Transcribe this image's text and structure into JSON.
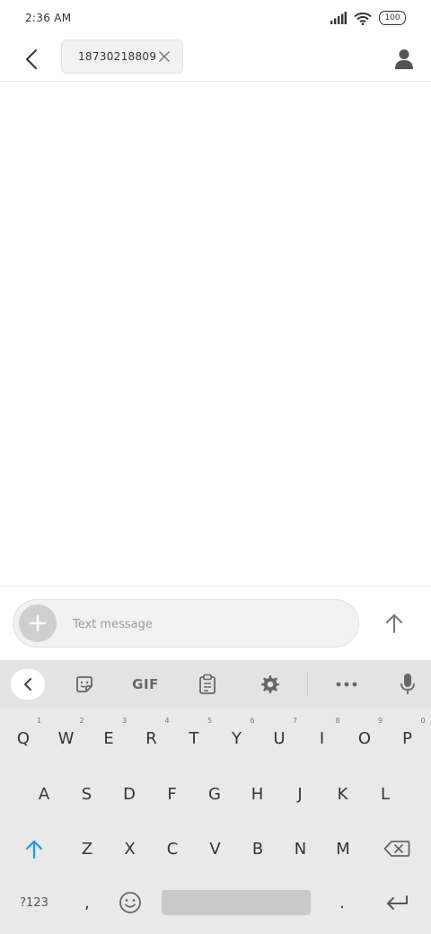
{
  "status_bar": {
    "time": "2:36 AM",
    "battery": "100",
    "icons": [
      "signal-icon",
      "wifi-icon",
      "battery-icon"
    ]
  },
  "header": {
    "back_icon": "back-arrow-icon",
    "recipient_chip": {
      "text": "18730218809",
      "remove_icon": "close-icon"
    },
    "contact_icon": "person-icon"
  },
  "compose": {
    "attach_icon": "plus-icon",
    "placeholder": "Text message",
    "value": "",
    "send_icon": "send-arrow-icon"
  },
  "keyboard": {
    "toolbar": {
      "back_icon": "chevron-left-icon",
      "sticker_icon": "sticker-icon",
      "gif_label": "GIF",
      "clipboard_icon": "clipboard-icon",
      "settings_icon": "gear-icon",
      "more_icon": "more-icon",
      "mic_icon": "mic-icon"
    },
    "row1": [
      "Q",
      "W",
      "E",
      "R",
      "T",
      "Y",
      "U",
      "I",
      "O",
      "P"
    ],
    "row1_hints": [
      "1",
      "2",
      "3",
      "4",
      "5",
      "6",
      "7",
      "8",
      "9",
      "0"
    ],
    "row2": [
      "A",
      "S",
      "D",
      "F",
      "G",
      "H",
      "J",
      "K",
      "L"
    ],
    "row3": [
      "Z",
      "X",
      "C",
      "V",
      "B",
      "N",
      "M"
    ],
    "bottom": {
      "symbols_label": "?123",
      "comma": ",",
      "emoji_icon": "emoji-icon",
      "period": ".",
      "enter_icon": "enter-icon",
      "shift_icon": "shift-icon",
      "backspace_icon": "backspace-icon"
    },
    "accent_color": "#2196f3"
  }
}
